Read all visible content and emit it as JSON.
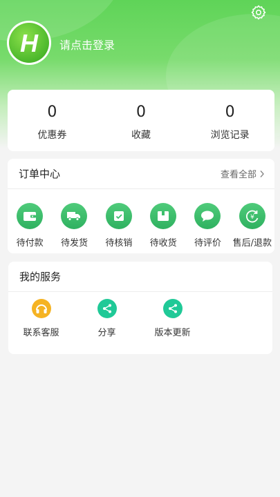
{
  "header": {
    "login_text": "请点击登录",
    "avatar_letter": "H",
    "settings_icon": "gear-icon"
  },
  "stats": [
    {
      "value": "0",
      "label": "优惠券"
    },
    {
      "value": "0",
      "label": "收藏"
    },
    {
      "value": "0",
      "label": "浏览记录"
    }
  ],
  "orders": {
    "title": "订单中心",
    "view_all": "查看全部",
    "items": [
      {
        "label": "待付款",
        "icon": "wallet-icon"
      },
      {
        "label": "待发货",
        "icon": "truck-icon"
      },
      {
        "label": "待核销",
        "icon": "check-voucher-icon"
      },
      {
        "label": "待收货",
        "icon": "package-icon"
      },
      {
        "label": "待评价",
        "icon": "comment-icon"
      },
      {
        "label": "售后/退款",
        "icon": "refund-icon"
      }
    ]
  },
  "services": {
    "title": "我的服务",
    "items": [
      {
        "label": "联系客服",
        "icon": "headset-icon"
      },
      {
        "label": "分享",
        "icon": "share-icon"
      },
      {
        "label": "版本更新",
        "icon": "share-icon"
      }
    ]
  },
  "colors": {
    "brand_green": "#5fd458",
    "icon_green": "#3cbf6c",
    "service_teal": "#20c997",
    "service_orange": "#f5b323"
  }
}
